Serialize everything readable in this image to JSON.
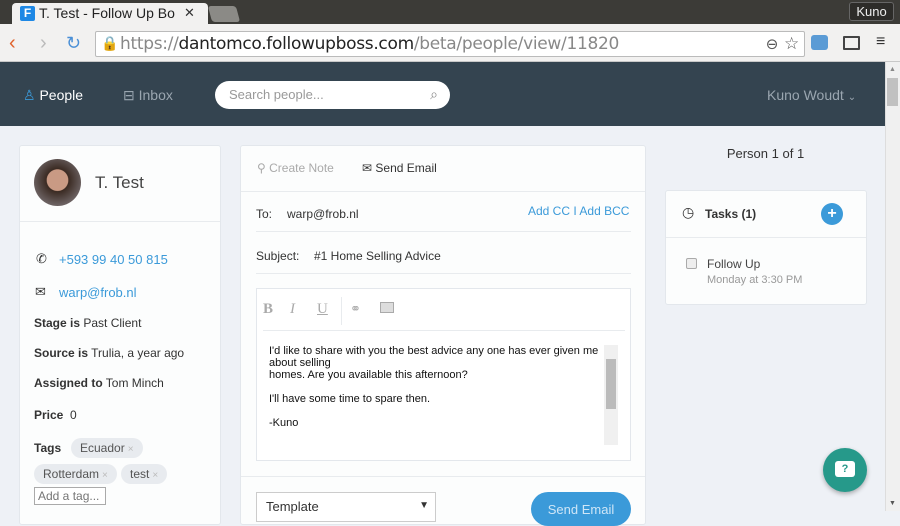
{
  "browser": {
    "tab_title": "T. Test - Follow Up Bo",
    "favicon_letter": "F",
    "user_button": "Kuno",
    "url_host": "https://dantomco.followupboss.com",
    "url_path": "/beta/people/view/11820",
    "url_scheme": "https://",
    "url_domain": "dantomco.followupboss.com"
  },
  "nav": {
    "people": "People",
    "inbox": "Inbox",
    "search_placeholder": "Search people...",
    "user": "Kuno Woudt"
  },
  "person": {
    "name": "T. Test",
    "phone": "+593 99 40 50 815",
    "email": "warp@frob.nl",
    "stage_label": "Stage is",
    "stage": "Past Client",
    "source_label": "Source is",
    "source": "Trulia, a year ago",
    "assigned_label": "Assigned to",
    "assigned": "Tom Minch",
    "price_label": "Price",
    "price": "0",
    "tags_label": "Tags",
    "tags": [
      "Ecuador",
      "Rotterdam",
      "test"
    ],
    "add_tag_placeholder": "Add a tag..."
  },
  "composer": {
    "create_note": "Create Note",
    "send_email_tab": "Send Email",
    "to_label": "To:",
    "to": "warp@frob.nl",
    "add_cc": "Add CC",
    "sep": "I",
    "add_bcc": "Add BCC",
    "subject_label": "Subject:",
    "subject": "#1 Home Selling Advice",
    "format_buttons": [
      "B",
      "I",
      "U"
    ],
    "body": "I'd like to share with you the best advice any one has ever given me about selling\nhomes. Are you available this afternoon?\n\nI'll have some time to spare then.\n\n-Kuno",
    "template_label": "Template",
    "send_button": "Send Email"
  },
  "pager": {
    "text_prefix": "Person ",
    "current": "1",
    "text_mid": " of ",
    "total": "1"
  },
  "tasks": {
    "title": "Tasks (1)",
    "items": [
      {
        "title": "Follow Up",
        "due": "Monday at 3:30 PM",
        "done": false
      }
    ]
  },
  "colors": {
    "accent": "#3b9ad9",
    "nav_bg": "#344450",
    "chat": "#26998a"
  }
}
